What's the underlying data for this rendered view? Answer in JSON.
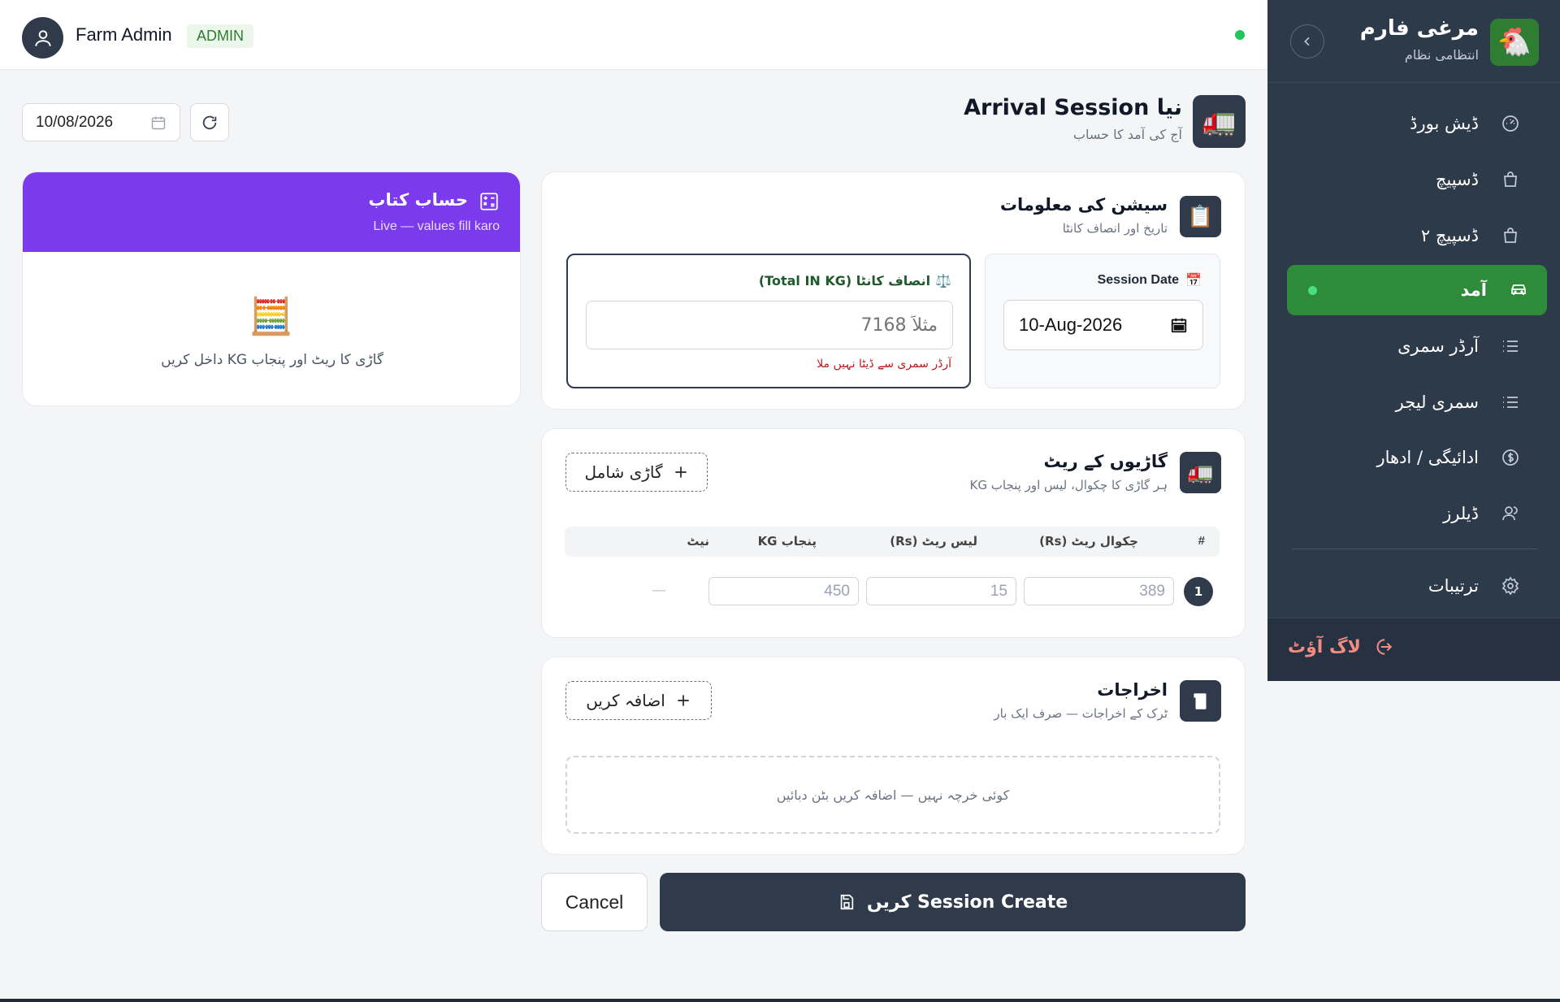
{
  "topbar": {
    "user_name": "Farm Admin",
    "role_badge": "ADMIN"
  },
  "sidebar": {
    "title": "مرغی فارم",
    "subtitle": "انتظامی نظام",
    "items": [
      {
        "label": "ڈیش بورڈ",
        "icon": "gauge-icon"
      },
      {
        "label": "ڈسپیچ",
        "icon": "shopping-bag-icon"
      },
      {
        "label": "ڈسپیچ ۲",
        "icon": "shopping-bag-icon"
      },
      {
        "label": "آمد",
        "icon": "car-icon",
        "active": true
      },
      {
        "label": "آرڈر سمری",
        "icon": "list-icon"
      },
      {
        "label": "سمری لیجر",
        "icon": "list-icon"
      },
      {
        "label": "ادائیگی / ادھار",
        "icon": "dollar-circle-icon"
      },
      {
        "label": "ڈیلرز",
        "icon": "users-icon"
      },
      {
        "label": "ترتیبات",
        "icon": "gear-icon"
      }
    ],
    "logout_label": "لاگ آؤٹ"
  },
  "toolbar": {
    "date_value": "10/08/2026"
  },
  "page": {
    "title": "نیا Arrival Session",
    "subtitle": "آج کی آمد کا حساب"
  },
  "ledger": {
    "title": "حساب کتاب",
    "subtitle": "Live — values fill karo",
    "empty_message": "گاڑی کا ریٹ اور پنجاب KG داخل کریں"
  },
  "session_info": {
    "title": "سیشن کی معلومات",
    "subtitle": "تاریخ اور انصاف کانٹا",
    "date_label": "Session Date",
    "date_value": "10-Aug-2026",
    "kanta_label": "انصاف کانٹا (Total IN KG)",
    "kanta_placeholder": "مثلاً 7168",
    "kanta_error": "آرڈر سمری سے ڈیٹا نہیں ملا"
  },
  "vehicle_rates": {
    "title": "گاڑیوں کے ریٹ",
    "subtitle": "ہر گاڑی کا چکوال، لیس اور پنجاب KG",
    "add_button": "گاڑی شامل",
    "columns": [
      "#",
      "چکوال ریٹ (Rs)",
      "لیس ریٹ (Rs)",
      "پنجاب KG",
      "نیٹ"
    ],
    "rows": [
      {
        "num": "1",
        "chakwal_placeholder": "389",
        "less_placeholder": "15",
        "punjab_placeholder": "450",
        "net": "—"
      }
    ]
  },
  "expenses": {
    "title": "اخراجات",
    "subtitle": "ٹرک کے اخراجات — صرف ایک بار",
    "add_button": "اضافہ کریں",
    "empty_message": "کوئی خرچہ نہیں — اضافہ کریں بٹن دبائیں"
  },
  "actions": {
    "cancel": "Cancel",
    "submit": "Session Create کریں"
  },
  "colors": {
    "sidebar_bg": "#2c3a4a",
    "active_green": "#2e8b3a",
    "ledger_purple": "#7c3aed",
    "primary_dark": "#2f3a4a",
    "error_red": "#b91c1c"
  }
}
